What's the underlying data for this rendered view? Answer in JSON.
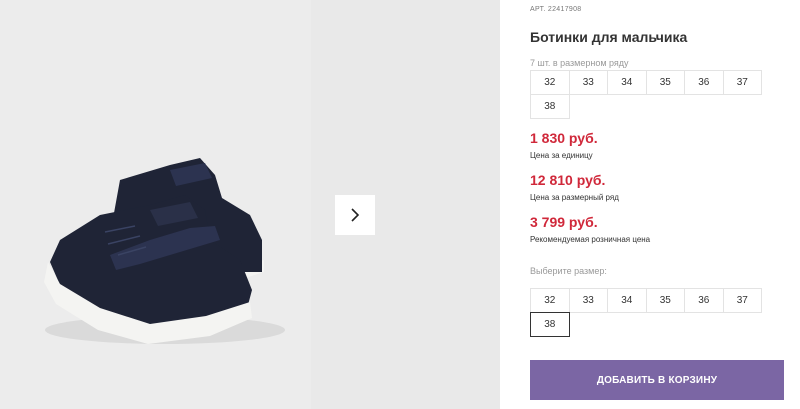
{
  "product": {
    "article_label": "АРТ.",
    "article_number": "22417908",
    "title": "Ботинки для мальчика",
    "series_hint": "7 шт. в размерном ряду",
    "series_sizes": [
      "32",
      "33",
      "34",
      "35",
      "36",
      "37",
      "38"
    ]
  },
  "prices": [
    {
      "value": "1 830 руб.",
      "note": "Цена за единицу"
    },
    {
      "value": "12 810 руб.",
      "note": "Цена за размерный ряд"
    },
    {
      "value": "3 799 руб.",
      "note": "Рекомендуемая розничная цена"
    }
  ],
  "size_select": {
    "label": "Выберите размер:",
    "options": [
      "32",
      "33",
      "34",
      "35",
      "36",
      "37",
      "38"
    ],
    "selected": "38"
  },
  "cart": {
    "button_label": "ДОБАВИТЬ В КОРЗИНУ"
  },
  "gallery": {
    "next_icon": "chevron-right-icon"
  },
  "colors": {
    "accent": "#7b66a4",
    "price": "#d0283a",
    "shoe": "#1f2436",
    "sole": "#f4f4f2"
  }
}
